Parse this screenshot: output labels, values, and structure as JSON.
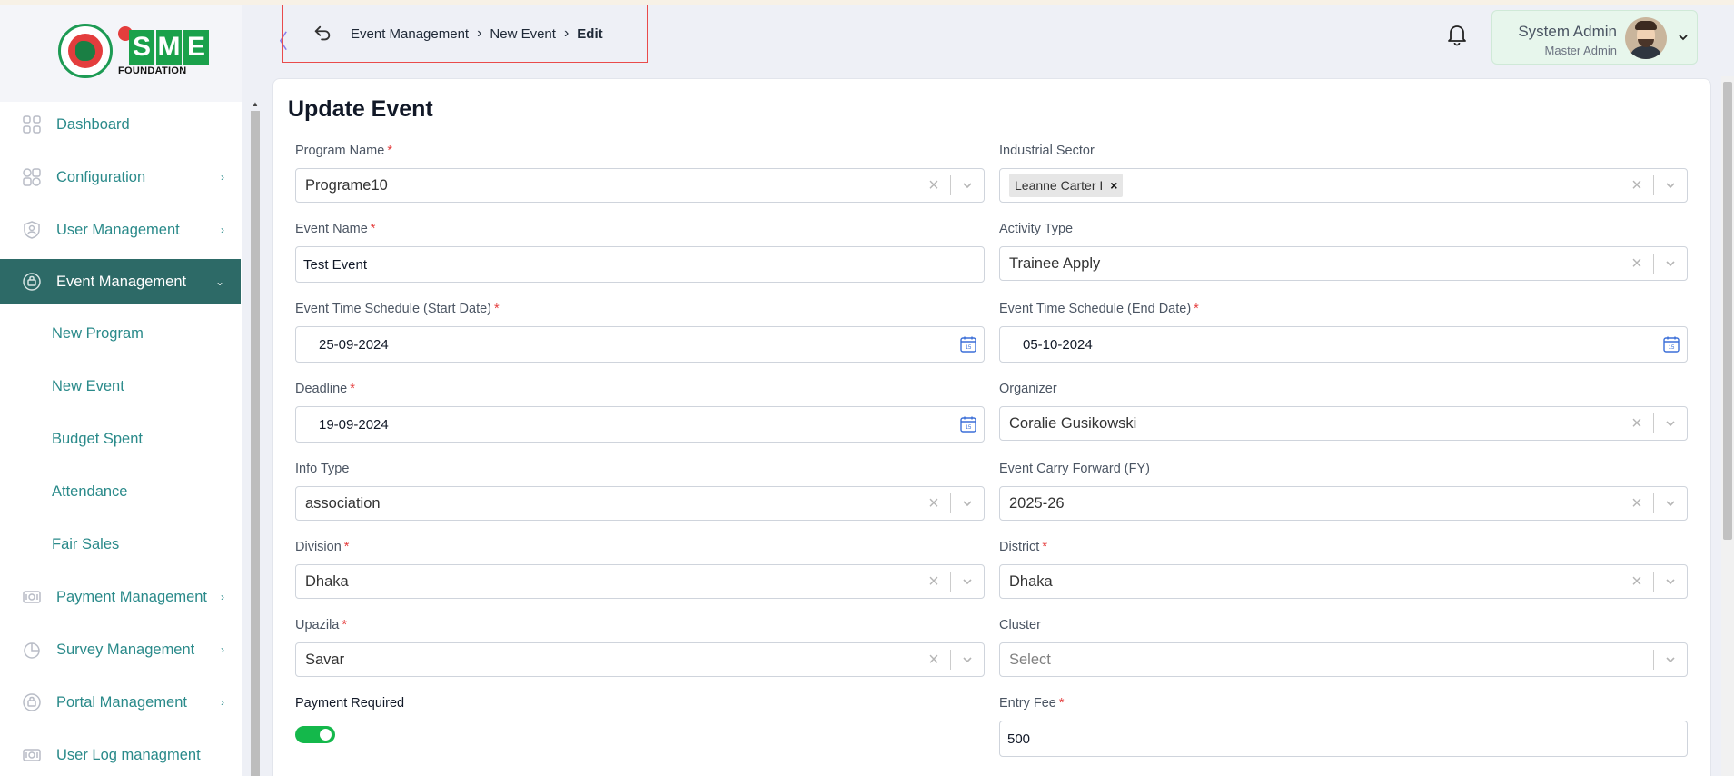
{
  "brand": {
    "logo_text": "SME",
    "logo_sub": "FOUNDATION"
  },
  "sidebar": {
    "items": [
      {
        "label": "Dashboard",
        "icon": "grid-icon",
        "expanded": false
      },
      {
        "label": "Configuration",
        "icon": "puzzle-icon",
        "has_children": true
      },
      {
        "label": "User Management",
        "icon": "user-shield-icon",
        "has_children": true
      },
      {
        "label": "Event Management",
        "icon": "event-icon",
        "has_children": true,
        "active": true
      },
      {
        "label": "Payment Management",
        "icon": "cash-icon",
        "has_children": true
      },
      {
        "label": "Survey Management",
        "icon": "pie-chart-icon",
        "has_children": true
      },
      {
        "label": "Portal Management",
        "icon": "portal-icon",
        "has_children": true
      },
      {
        "label": "User Log managment",
        "icon": "log-icon",
        "has_children": false
      }
    ],
    "sub_items": [
      {
        "label": "New Program"
      },
      {
        "label": "New Event"
      },
      {
        "label": "Budget Spent"
      },
      {
        "label": "Attendance"
      },
      {
        "label": "Fair Sales"
      }
    ]
  },
  "header": {
    "breadcrumb": [
      "Event Management",
      "New Event",
      "Edit"
    ],
    "user_name": "System Admin",
    "user_role": "Master Admin"
  },
  "form": {
    "title": "Update Event",
    "program_name": {
      "label": "Program Name",
      "value": "Programe10"
    },
    "industrial_sector": {
      "label": "Industrial Sector",
      "tag": "Leanne Carter I"
    },
    "event_name": {
      "label": "Event Name",
      "value": "Test Event"
    },
    "activity_type": {
      "label": "Activity Type",
      "value": "Trainee Apply"
    },
    "start_date": {
      "label": "Event Time Schedule (Start Date)",
      "value": "25-09-2024"
    },
    "end_date": {
      "label": "Event Time Schedule (End Date)",
      "value": "05-10-2024"
    },
    "deadline": {
      "label": "Deadline",
      "value": "19-09-2024"
    },
    "organizer": {
      "label": "Organizer",
      "value": "Coralie Gusikowski"
    },
    "info_type": {
      "label": "Info Type",
      "value": "association"
    },
    "carry_forward": {
      "label": "Event Carry Forward (FY)",
      "value": "2025-26"
    },
    "division": {
      "label": "Division",
      "value": "Dhaka"
    },
    "district": {
      "label": "District",
      "value": "Dhaka"
    },
    "upazila": {
      "label": "Upazila",
      "value": "Savar"
    },
    "cluster": {
      "label": "Cluster",
      "placeholder": "Select"
    },
    "payment_required": {
      "label": "Payment Required",
      "on": true
    },
    "entry_fee": {
      "label": "Entry Fee",
      "value": "500"
    },
    "required_mark": "*"
  },
  "colors": {
    "accent": "#2d6a67",
    "link": "#2a8a8a",
    "toggle_on": "#14b84b",
    "required": "#e53e3e"
  }
}
